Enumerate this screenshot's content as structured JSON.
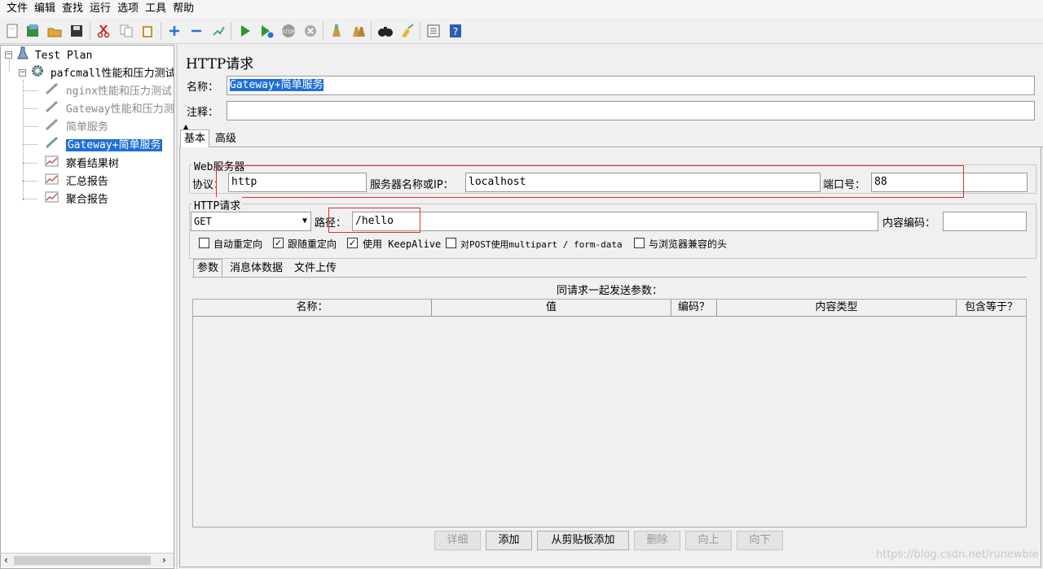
{
  "menu": [
    "文件",
    "编辑",
    "查找",
    "运行",
    "选项",
    "工具",
    "帮助"
  ],
  "toolbar_icons": [
    "new-icon",
    "templates-icon",
    "open-icon",
    "save-icon",
    "cut-icon",
    "copy-icon",
    "paste-icon",
    "expand-icon",
    "collapse-icon",
    "toggle-icon",
    "start-icon",
    "start-no-pause-icon",
    "stop-icon",
    "shutdown-icon",
    "clear-icon",
    "clear-all-icon",
    "search-icon",
    "reset-search-icon",
    "function-helper-icon",
    "help-icon"
  ],
  "tree": {
    "root": "Test Plan",
    "group": "pafcmall性能和压力测试",
    "items": [
      "nginx性能和压力测试",
      "Gateway性能和压力测",
      "简单服务",
      "Gateway+简单服务",
      "察看结果树",
      "汇总报告",
      "聚合报告"
    ]
  },
  "panel": {
    "title": "HTTP请求",
    "name_label": "名称：",
    "name_value": "Gateway+简单服务",
    "comment_label": "注释：",
    "comment_value": "",
    "tabs": [
      "基本",
      "高级"
    ],
    "web_server": {
      "legend": "Web服务器",
      "protocol_label": "协议：",
      "protocol_value": "http",
      "server_label": "服务器名称或IP：",
      "server_value": "localhost",
      "port_label": "端口号：",
      "port_value": "88"
    },
    "http_request": {
      "legend": "HTTP请求",
      "method": "GET",
      "path_label": "路径：",
      "path_value": "/hello",
      "encoding_label": "内容编码：",
      "encoding_value": ""
    },
    "options": [
      {
        "label": "自动重定向",
        "checked": false
      },
      {
        "label": "跟随重定向",
        "checked": true
      },
      {
        "label": "使用 KeepAlive",
        "checked": true
      },
      {
        "label": "对POST使用multipart / form-data",
        "checked": false
      },
      {
        "label": "与浏览器兼容的头",
        "checked": false
      }
    ],
    "subtabs": [
      "参数",
      "消息体数据",
      "文件上传"
    ],
    "params_title": "同请求一起发送参数：",
    "columns": [
      "名称：",
      "值",
      "编码？",
      "内容类型",
      "包含等于？"
    ],
    "buttons": [
      {
        "label": "详细",
        "enabled": false
      },
      {
        "label": "添加",
        "enabled": true
      },
      {
        "label": "从剪贴板添加",
        "enabled": true
      },
      {
        "label": "删除",
        "enabled": false
      },
      {
        "label": "向上",
        "enabled": false
      },
      {
        "label": "向下",
        "enabled": false
      }
    ],
    "watermark": "https://blog.csdn.net/runewbie"
  }
}
